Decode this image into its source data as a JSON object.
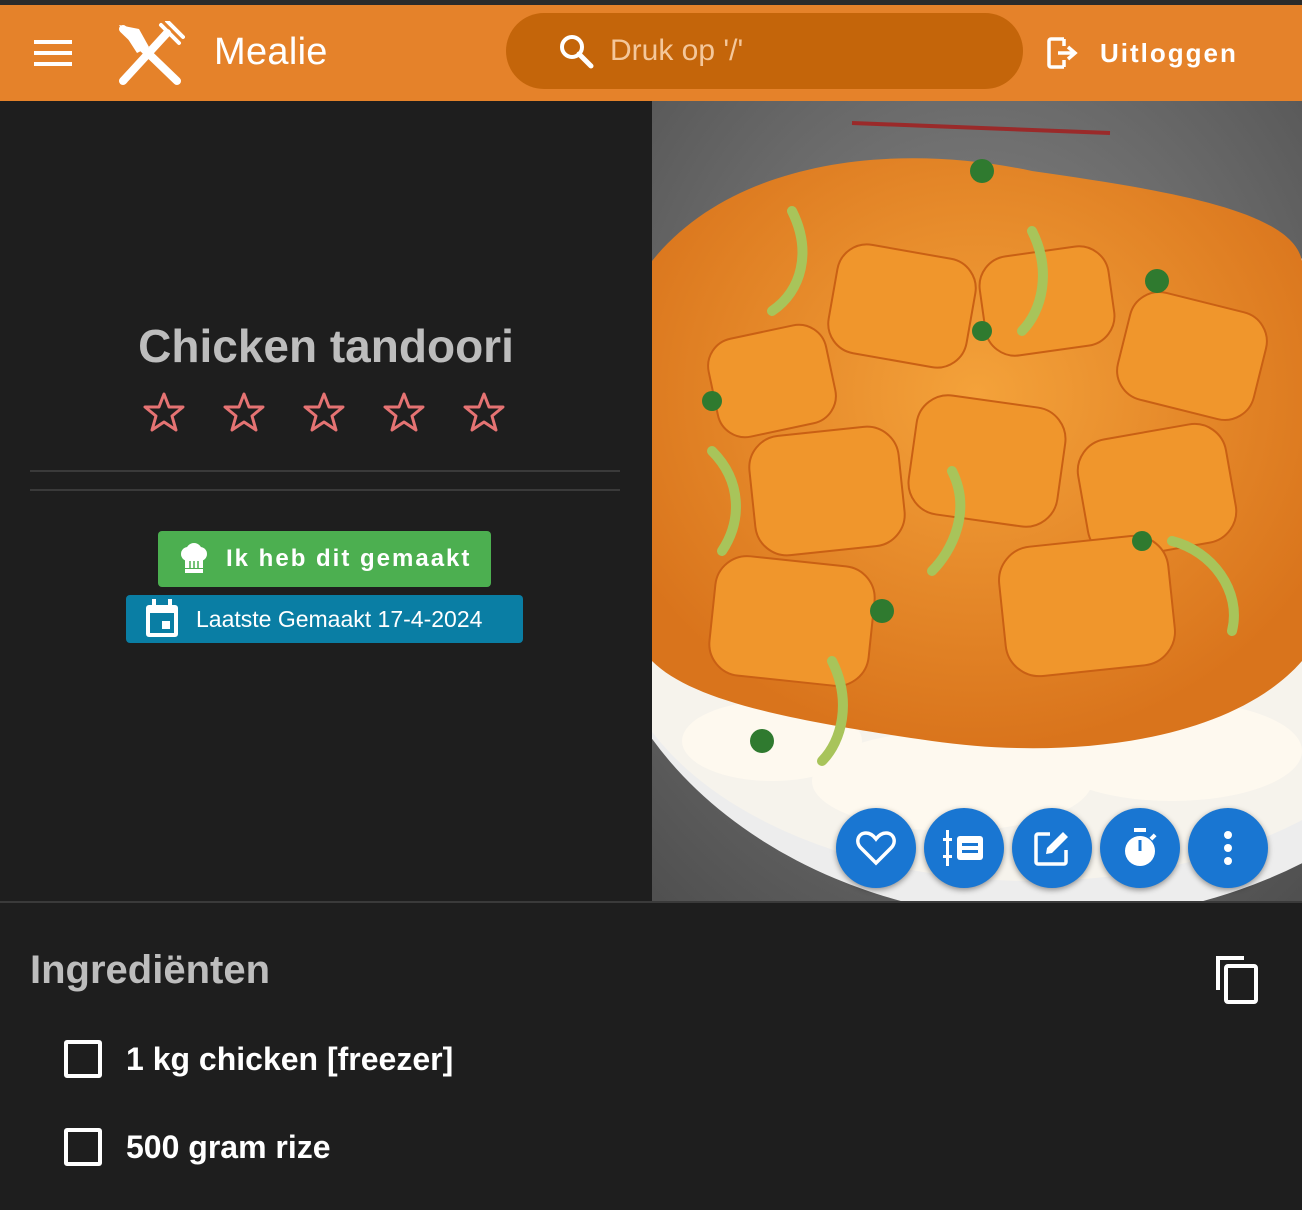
{
  "app": {
    "title": "Mealie"
  },
  "search": {
    "placeholder": "Druk op '/'"
  },
  "header": {
    "logout_label": "Uitloggen"
  },
  "recipe": {
    "title": "Chicken tandoori",
    "rating": 0,
    "rating_max": 5,
    "made_button_label": "Ik heb dit gemaakt",
    "last_made_label": "Laatste Gemaakt 17-4-2024"
  },
  "actions": [
    "heart-icon",
    "list-icon",
    "edit-icon",
    "timer-icon",
    "more-icon"
  ],
  "ingredients": {
    "title": "Ingrediënten",
    "items": [
      {
        "label": "1 kg chicken [freezer]",
        "checked": false
      },
      {
        "label": "500 gram rize",
        "checked": false
      }
    ]
  },
  "colors": {
    "appbar": "#e5822a",
    "search_bg": "#c4650a",
    "made_button": "#4caf50",
    "last_made": "#0a7ea4",
    "fab": "#1976d2",
    "star": "#e57373"
  }
}
